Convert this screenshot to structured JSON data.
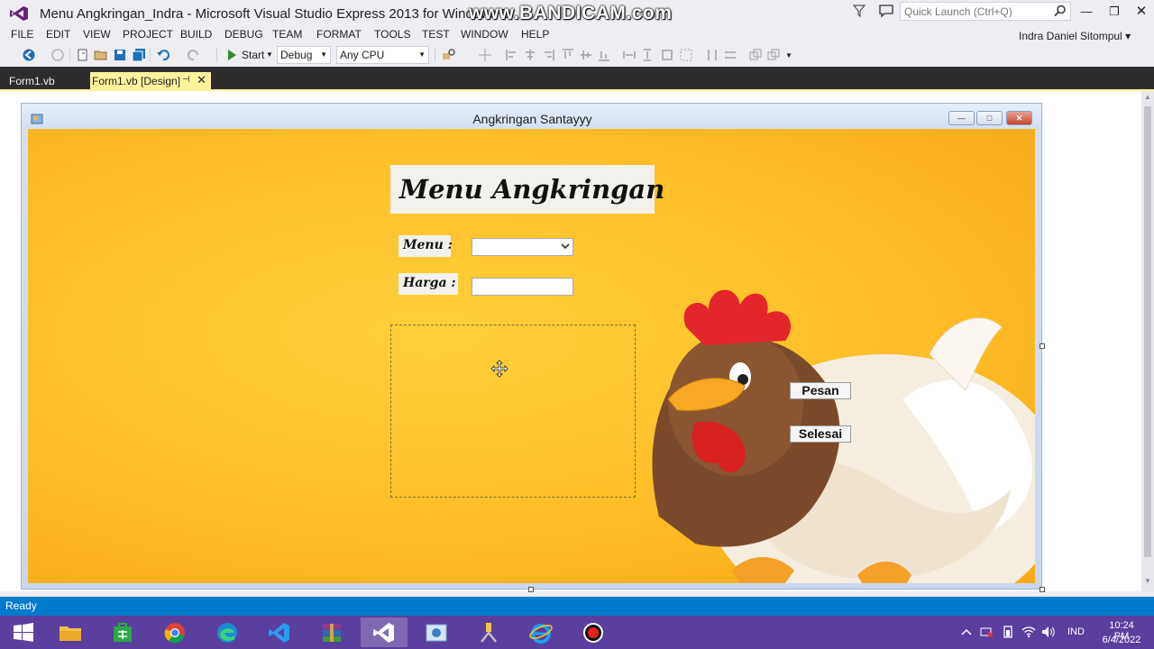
{
  "window": {
    "title": "Menu Angkringan_Indra - Microsoft Visual Studio Express 2013 for Windows D",
    "watermark": "www.BANDICAM.com",
    "quick_launch_placeholder": "Quick Launch (Ctrl+Q)",
    "user_name": "Indra Daniel Sitompul"
  },
  "menu": [
    "FILE",
    "EDIT",
    "VIEW",
    "PROJECT",
    "BUILD",
    "DEBUG",
    "TEAM",
    "FORMAT",
    "TOOLS",
    "TEST",
    "WINDOW",
    "HELP"
  ],
  "toolbar": {
    "start_label": "Start",
    "configuration": "Debug",
    "platform": "Any CPU"
  },
  "tabs": {
    "code_tab": "Form1.vb",
    "design_tab": "Form1.vb [Design]"
  },
  "form": {
    "caption": "Angkringan Santayyy",
    "heading": "Menu Angkringan",
    "menu_label": "Menu :",
    "harga_label": "Harga :",
    "menu_value": "",
    "harga_value": "",
    "pesan_button": "Pesan",
    "selesai_button": "Selesai"
  },
  "status": {
    "text": "Ready"
  },
  "taskbar": {
    "apps": [
      "start-icon",
      "file-explorer-icon",
      "store-icon",
      "chrome-icon",
      "edge-icon",
      "vscode-icon",
      "winrar-icon",
      "visual-studio-icon",
      "photos-icon",
      "tools-icon",
      "internet-explorer-icon",
      "bandicam-record-icon"
    ],
    "language": "IND",
    "time": "10:24 PM",
    "date": "6/4/2022"
  },
  "colors": {
    "vs_purple": "#68217a",
    "status_blue": "#007acc",
    "tab_yellow": "#fff29d",
    "taskbar_purple": "#5b3f9e",
    "form_orange": "#ffbe28"
  }
}
